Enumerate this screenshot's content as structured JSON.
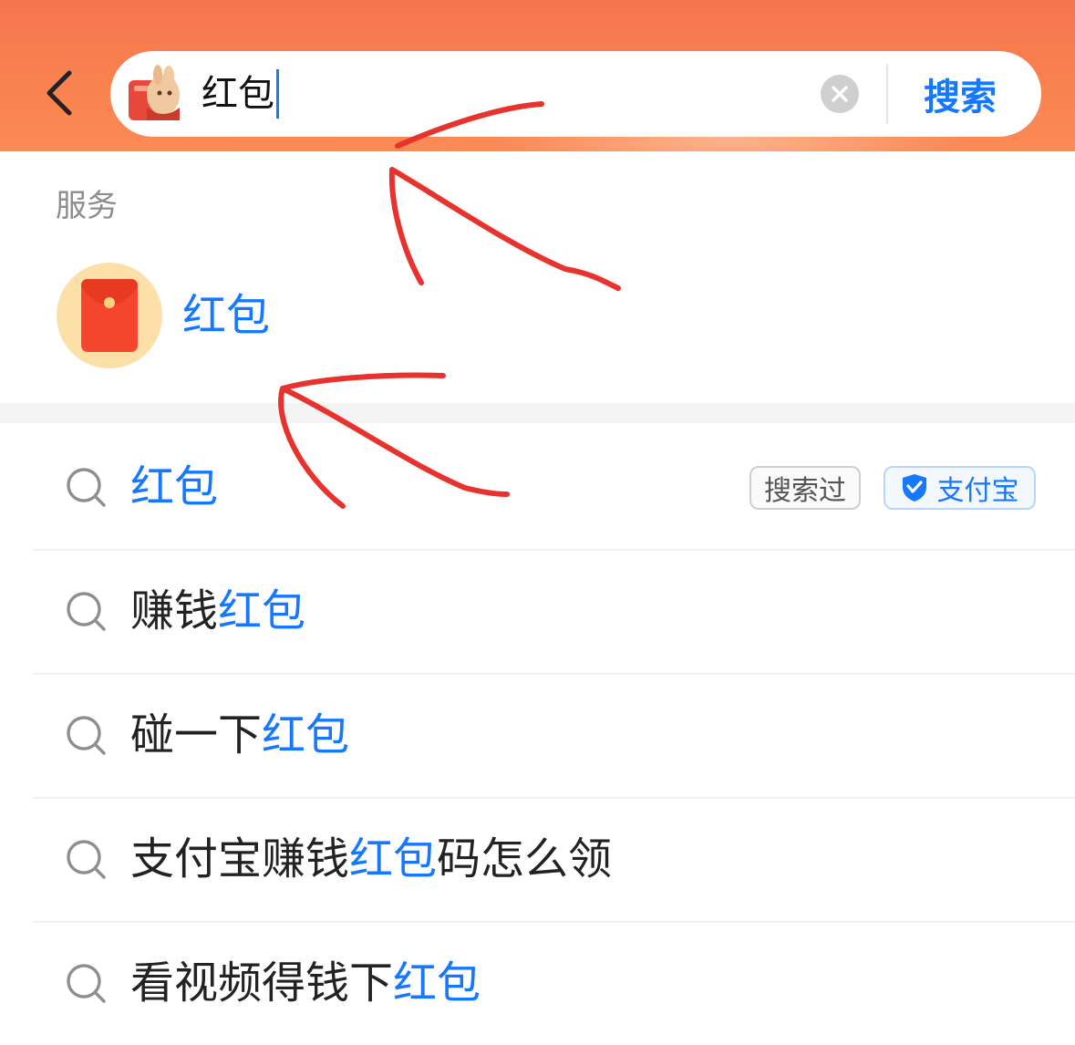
{
  "header": {
    "back_icon": "chevron-left-icon",
    "mascot_icon": "mascot-icon",
    "query": "红包",
    "clear_icon": "clear-icon",
    "search_label": "搜索"
  },
  "service_section": {
    "label": "服务",
    "item": {
      "label": "红包",
      "icon": "red-envelope-icon"
    }
  },
  "suggestions": [
    {
      "prefix": "",
      "highlight": "红包",
      "suffix": "",
      "tags": [
        "搜索过",
        "支付宝"
      ]
    },
    {
      "prefix": "赚钱",
      "highlight": "红包",
      "suffix": "",
      "tags": []
    },
    {
      "prefix": "碰一下",
      "highlight": "红包",
      "suffix": "",
      "tags": []
    },
    {
      "prefix": "支付宝赚钱",
      "highlight": "红包",
      "suffix": "码怎么领",
      "tags": []
    },
    {
      "prefix": "看视频得钱下",
      "highlight": "红包",
      "suffix": "",
      "tags": []
    }
  ],
  "tags": {
    "history": "搜索过",
    "alipay": "支付宝",
    "alipay_icon": "shield-check-icon"
  },
  "colors": {
    "header": "#f57450",
    "accent": "#1677ff",
    "annotation": "#e8322e",
    "envelope": "#f5452d",
    "envelope_bg": "#fce0a8"
  }
}
